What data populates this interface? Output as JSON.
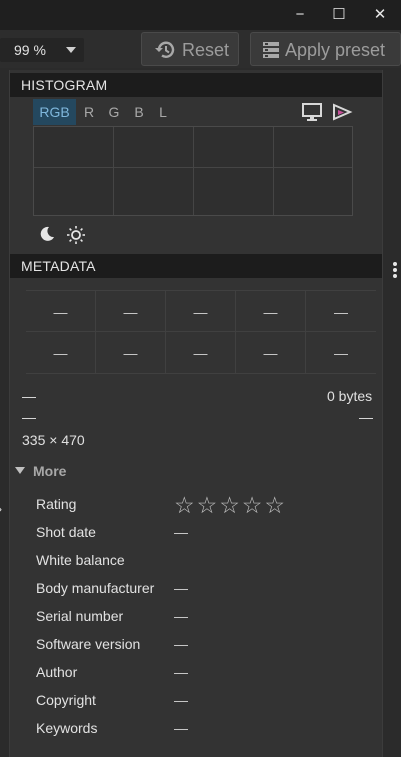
{
  "window": {
    "minimize_glyph": "−",
    "maximize_glyph": "☐",
    "close_glyph": "✕"
  },
  "toolbar": {
    "zoom_value": "99 %",
    "reset_label": "Reset",
    "apply_preset_label": "Apply preset",
    "reset_icon": "history-icon",
    "preset_icon": "preset-list-icon"
  },
  "histogram": {
    "title": "HISTOGRAM",
    "channels": [
      "RGB",
      "R",
      "G",
      "B",
      "L"
    ],
    "active_channel": "RGB",
    "right_icons": [
      "monitor-icon",
      "softproof-icon"
    ],
    "bottom_icons": [
      "moon-icon",
      "sun-icon"
    ]
  },
  "metadata": {
    "title": "METADATA",
    "grid_row1": [
      "—",
      "—",
      "—",
      "—",
      "—"
    ],
    "grid_row2": [
      "—",
      "—",
      "—",
      "—",
      "—"
    ],
    "line1_left": "—",
    "line1_right": "0 bytes",
    "line2_left": "—",
    "line2_right": "—",
    "dimensions": "335 × 470",
    "more_label": "More",
    "rating_label": "Rating",
    "rating_stars": 0,
    "rating_max": 5,
    "fields": [
      {
        "key": "Shot date",
        "value": "—"
      },
      {
        "key": "White balance",
        "value": ""
      },
      {
        "key": "Body manufacturer",
        "value": "—"
      },
      {
        "key": "Serial number",
        "value": "—"
      },
      {
        "key": "Software version",
        "value": "—"
      },
      {
        "key": "Author",
        "value": "—"
      },
      {
        "key": "Copyright",
        "value": "—"
      },
      {
        "key": "Keywords",
        "value": "—"
      }
    ]
  },
  "colors": {
    "accent": "#24485f",
    "accent_text": "#7fb7dc"
  }
}
